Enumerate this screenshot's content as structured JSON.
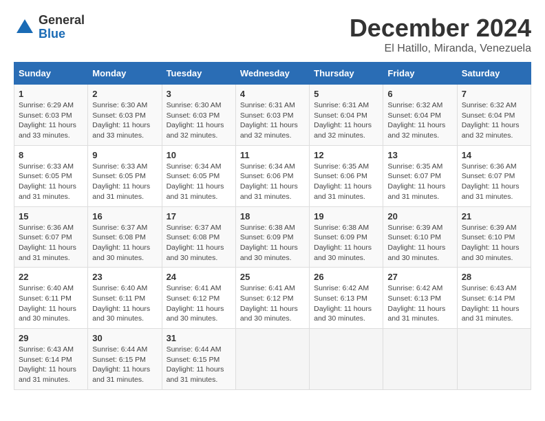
{
  "logo": {
    "general": "General",
    "blue": "Blue"
  },
  "header": {
    "title": "December 2024",
    "subtitle": "El Hatillo, Miranda, Venezuela"
  },
  "columns": [
    "Sunday",
    "Monday",
    "Tuesday",
    "Wednesday",
    "Thursday",
    "Friday",
    "Saturday"
  ],
  "weeks": [
    [
      {
        "day": "1",
        "sunrise": "Sunrise: 6:29 AM",
        "sunset": "Sunset: 6:03 PM",
        "daylight": "Daylight: 11 hours and 33 minutes."
      },
      {
        "day": "2",
        "sunrise": "Sunrise: 6:30 AM",
        "sunset": "Sunset: 6:03 PM",
        "daylight": "Daylight: 11 hours and 33 minutes."
      },
      {
        "day": "3",
        "sunrise": "Sunrise: 6:30 AM",
        "sunset": "Sunset: 6:03 PM",
        "daylight": "Daylight: 11 hours and 32 minutes."
      },
      {
        "day": "4",
        "sunrise": "Sunrise: 6:31 AM",
        "sunset": "Sunset: 6:03 PM",
        "daylight": "Daylight: 11 hours and 32 minutes."
      },
      {
        "day": "5",
        "sunrise": "Sunrise: 6:31 AM",
        "sunset": "Sunset: 6:04 PM",
        "daylight": "Daylight: 11 hours and 32 minutes."
      },
      {
        "day": "6",
        "sunrise": "Sunrise: 6:32 AM",
        "sunset": "Sunset: 6:04 PM",
        "daylight": "Daylight: 11 hours and 32 minutes."
      },
      {
        "day": "7",
        "sunrise": "Sunrise: 6:32 AM",
        "sunset": "Sunset: 6:04 PM",
        "daylight": "Daylight: 11 hours and 32 minutes."
      }
    ],
    [
      {
        "day": "8",
        "sunrise": "Sunrise: 6:33 AM",
        "sunset": "Sunset: 6:05 PM",
        "daylight": "Daylight: 11 hours and 31 minutes."
      },
      {
        "day": "9",
        "sunrise": "Sunrise: 6:33 AM",
        "sunset": "Sunset: 6:05 PM",
        "daylight": "Daylight: 11 hours and 31 minutes."
      },
      {
        "day": "10",
        "sunrise": "Sunrise: 6:34 AM",
        "sunset": "Sunset: 6:05 PM",
        "daylight": "Daylight: 11 hours and 31 minutes."
      },
      {
        "day": "11",
        "sunrise": "Sunrise: 6:34 AM",
        "sunset": "Sunset: 6:06 PM",
        "daylight": "Daylight: 11 hours and 31 minutes."
      },
      {
        "day": "12",
        "sunrise": "Sunrise: 6:35 AM",
        "sunset": "Sunset: 6:06 PM",
        "daylight": "Daylight: 11 hours and 31 minutes."
      },
      {
        "day": "13",
        "sunrise": "Sunrise: 6:35 AM",
        "sunset": "Sunset: 6:07 PM",
        "daylight": "Daylight: 11 hours and 31 minutes."
      },
      {
        "day": "14",
        "sunrise": "Sunrise: 6:36 AM",
        "sunset": "Sunset: 6:07 PM",
        "daylight": "Daylight: 11 hours and 31 minutes."
      }
    ],
    [
      {
        "day": "15",
        "sunrise": "Sunrise: 6:36 AM",
        "sunset": "Sunset: 6:07 PM",
        "daylight": "Daylight: 11 hours and 31 minutes."
      },
      {
        "day": "16",
        "sunrise": "Sunrise: 6:37 AM",
        "sunset": "Sunset: 6:08 PM",
        "daylight": "Daylight: 11 hours and 30 minutes."
      },
      {
        "day": "17",
        "sunrise": "Sunrise: 6:37 AM",
        "sunset": "Sunset: 6:08 PM",
        "daylight": "Daylight: 11 hours and 30 minutes."
      },
      {
        "day": "18",
        "sunrise": "Sunrise: 6:38 AM",
        "sunset": "Sunset: 6:09 PM",
        "daylight": "Daylight: 11 hours and 30 minutes."
      },
      {
        "day": "19",
        "sunrise": "Sunrise: 6:38 AM",
        "sunset": "Sunset: 6:09 PM",
        "daylight": "Daylight: 11 hours and 30 minutes."
      },
      {
        "day": "20",
        "sunrise": "Sunrise: 6:39 AM",
        "sunset": "Sunset: 6:10 PM",
        "daylight": "Daylight: 11 hours and 30 minutes."
      },
      {
        "day": "21",
        "sunrise": "Sunrise: 6:39 AM",
        "sunset": "Sunset: 6:10 PM",
        "daylight": "Daylight: 11 hours and 30 minutes."
      }
    ],
    [
      {
        "day": "22",
        "sunrise": "Sunrise: 6:40 AM",
        "sunset": "Sunset: 6:11 PM",
        "daylight": "Daylight: 11 hours and 30 minutes."
      },
      {
        "day": "23",
        "sunrise": "Sunrise: 6:40 AM",
        "sunset": "Sunset: 6:11 PM",
        "daylight": "Daylight: 11 hours and 30 minutes."
      },
      {
        "day": "24",
        "sunrise": "Sunrise: 6:41 AM",
        "sunset": "Sunset: 6:12 PM",
        "daylight": "Daylight: 11 hours and 30 minutes."
      },
      {
        "day": "25",
        "sunrise": "Sunrise: 6:41 AM",
        "sunset": "Sunset: 6:12 PM",
        "daylight": "Daylight: 11 hours and 30 minutes."
      },
      {
        "day": "26",
        "sunrise": "Sunrise: 6:42 AM",
        "sunset": "Sunset: 6:13 PM",
        "daylight": "Daylight: 11 hours and 30 minutes."
      },
      {
        "day": "27",
        "sunrise": "Sunrise: 6:42 AM",
        "sunset": "Sunset: 6:13 PM",
        "daylight": "Daylight: 11 hours and 31 minutes."
      },
      {
        "day": "28",
        "sunrise": "Sunrise: 6:43 AM",
        "sunset": "Sunset: 6:14 PM",
        "daylight": "Daylight: 11 hours and 31 minutes."
      }
    ],
    [
      {
        "day": "29",
        "sunrise": "Sunrise: 6:43 AM",
        "sunset": "Sunset: 6:14 PM",
        "daylight": "Daylight: 11 hours and 31 minutes."
      },
      {
        "day": "30",
        "sunrise": "Sunrise: 6:44 AM",
        "sunset": "Sunset: 6:15 PM",
        "daylight": "Daylight: 11 hours and 31 minutes."
      },
      {
        "day": "31",
        "sunrise": "Sunrise: 6:44 AM",
        "sunset": "Sunset: 6:15 PM",
        "daylight": "Daylight: 11 hours and 31 minutes."
      },
      null,
      null,
      null,
      null
    ]
  ]
}
